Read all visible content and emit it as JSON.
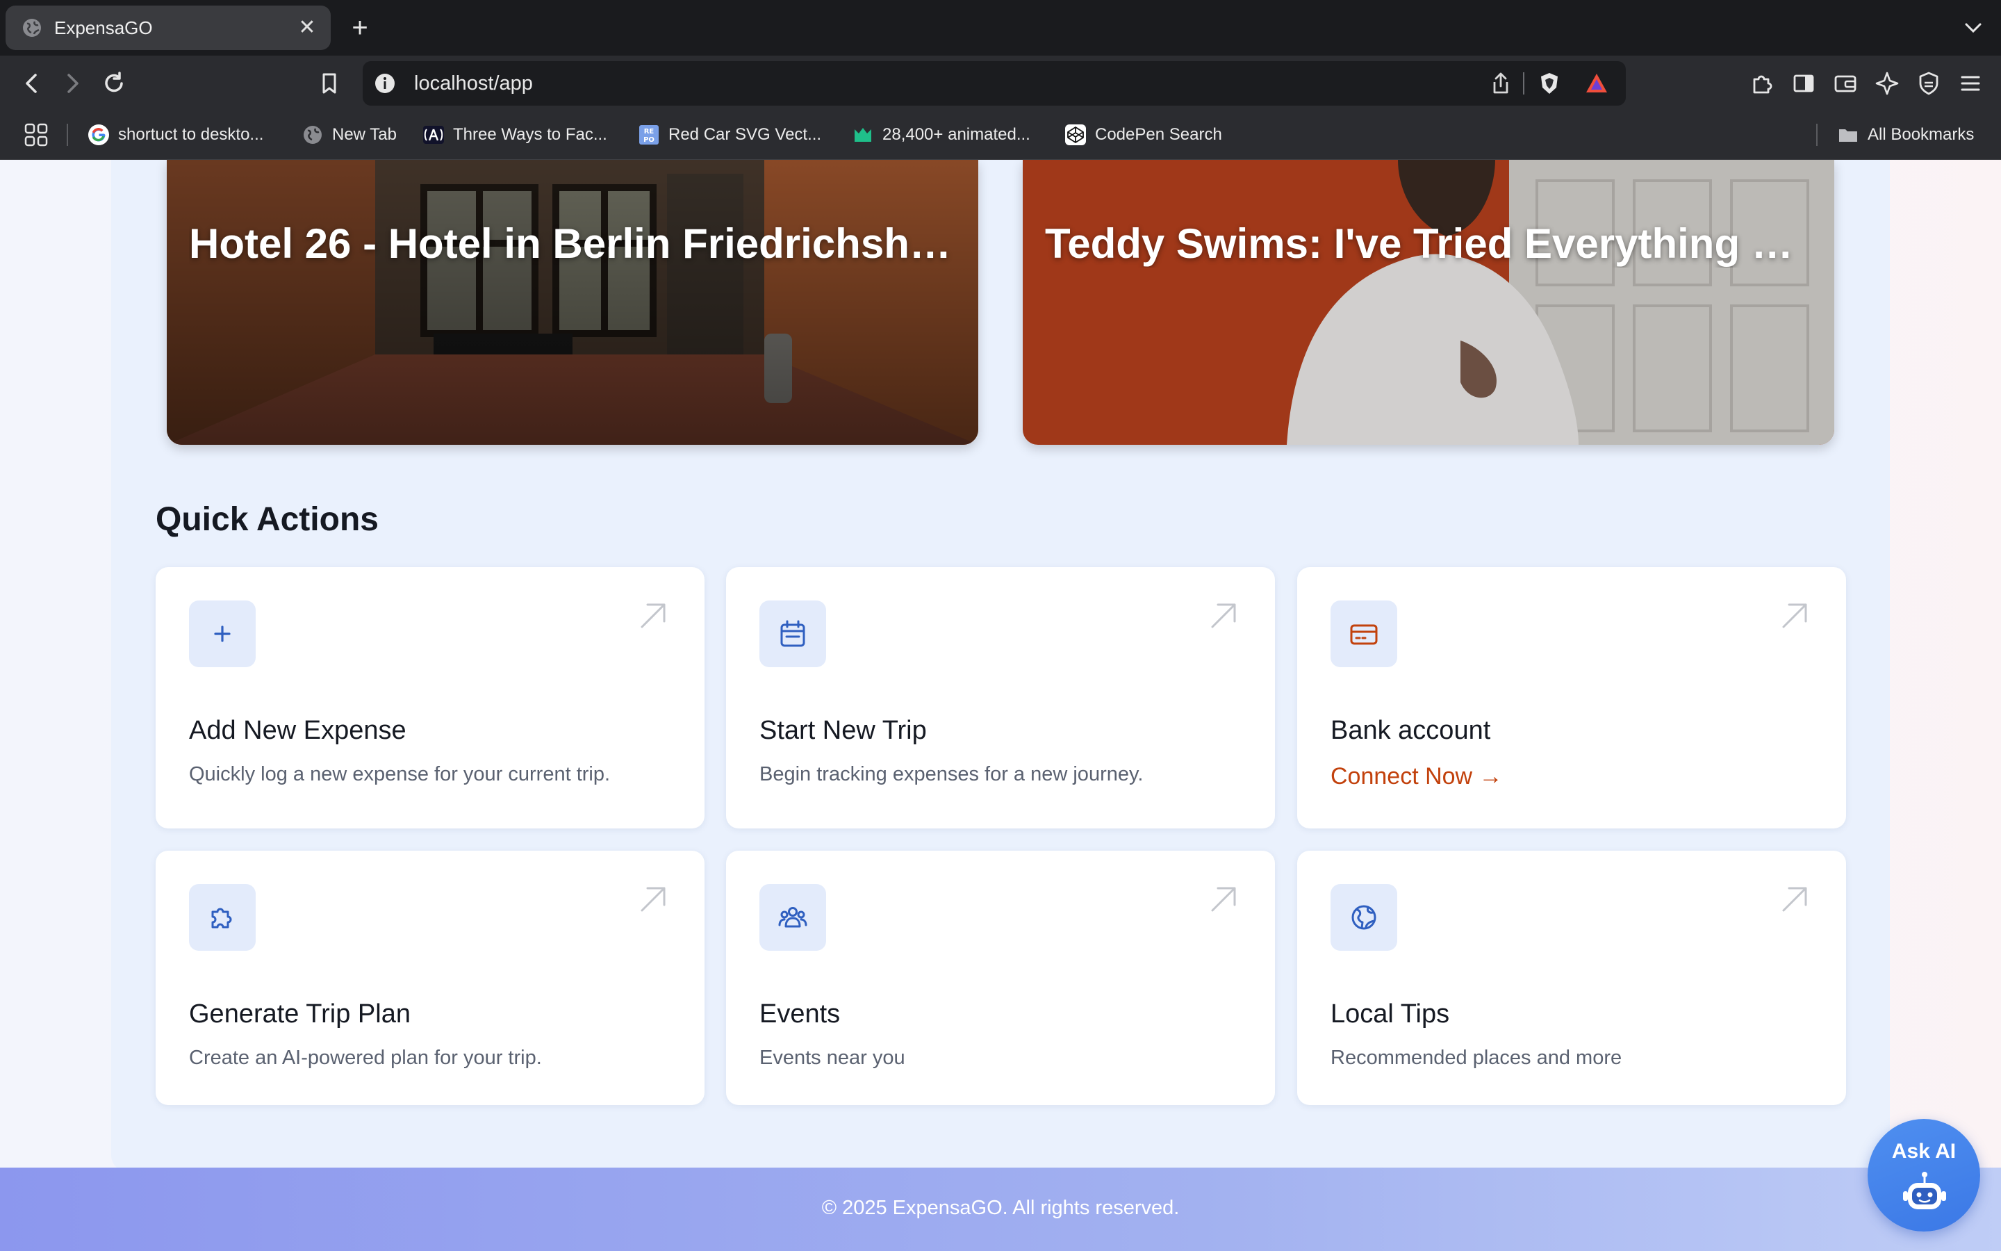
{
  "browser": {
    "tab": {
      "title": "ExpensaGO",
      "close": "✕"
    },
    "new_tab": "+",
    "url": "localhost/app",
    "bookmarks": [
      {
        "label": "shortuct to deskto...",
        "icon": "google-icon"
      },
      {
        "label": "New Tab",
        "icon": "globe-icon"
      },
      {
        "label": "Three Ways to Fac...",
        "icon": "angular-icon"
      },
      {
        "label": "Red Car SVG Vect...",
        "icon": "repo-icon"
      },
      {
        "label": "28,400+ animated...",
        "icon": "lottie-icon"
      },
      {
        "label": "CodePen Search",
        "icon": "codepen-icon"
      }
    ],
    "all_bookmarks": "All Bookmarks"
  },
  "hero_cards": [
    {
      "title": "Hotel 26 - Hotel in Berlin Friedrichshai..."
    },
    {
      "title": "Teddy Swims: I've Tried Everything But..."
    }
  ],
  "quick_actions": {
    "title": "Quick Actions",
    "cards": [
      {
        "title": "Add New Expense",
        "description": "Quickly log a new expense for your current trip.",
        "icon": "plus-icon"
      },
      {
        "title": "Start New Trip",
        "description": "Begin tracking expenses for a new journey.",
        "icon": "calendar-icon"
      },
      {
        "title": "Bank account",
        "link": "Connect Now →",
        "icon": "credit-card-icon"
      },
      {
        "title": "Generate Trip Plan",
        "description": "Create an AI-powered plan for your trip.",
        "icon": "puzzle-icon"
      },
      {
        "title": "Events",
        "description": "Events near you",
        "icon": "users-icon"
      },
      {
        "title": "Local Tips",
        "description": "Recommended places and more",
        "icon": "globe-icon"
      }
    ]
  },
  "footer": {
    "text": "© 2025 ExpensaGO. All rights reserved."
  },
  "ask_ai": {
    "label": "Ask AI"
  },
  "colors": {
    "accent": "#2f5fc0",
    "connect_link": "#c2410c",
    "panel": "#eaf1fd",
    "footer_start": "#8c97ee",
    "footer_end": "#bfcdf6"
  }
}
